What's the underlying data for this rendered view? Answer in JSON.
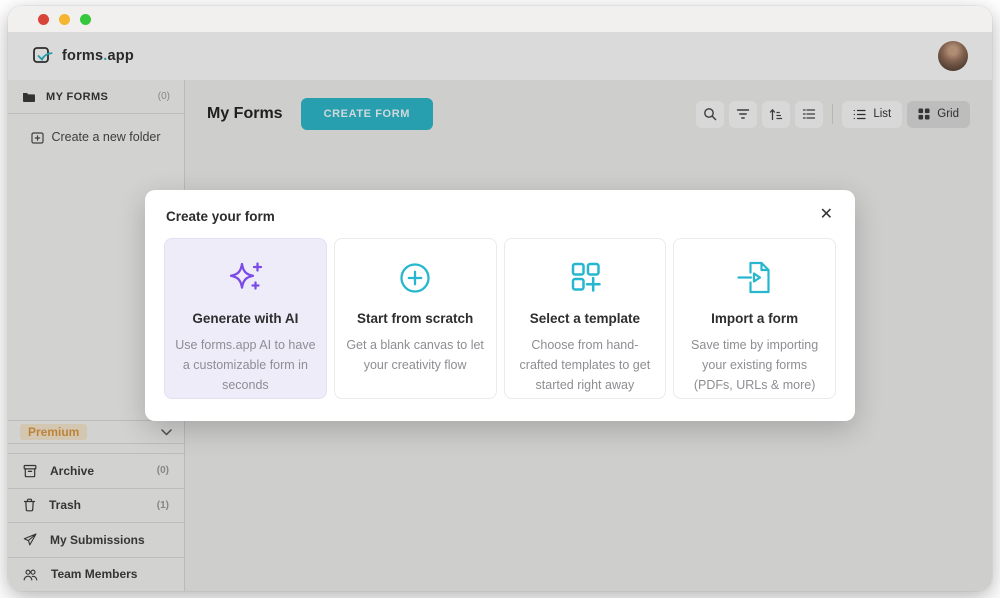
{
  "colors": {
    "accent_teal": "#29b6c6",
    "icon_teal": "#26b7cf",
    "ai_purple": "#7b4ce8",
    "ai_card_bg": "#efecfa",
    "premium_orange": "#dd9840",
    "traffic_red": "#d8433a",
    "traffic_yellow": "#f5b52e",
    "traffic_green": "#35c83c"
  },
  "brand": {
    "name_a": "forms",
    "dot": ".",
    "name_b": "app"
  },
  "sidebar": {
    "my_forms": {
      "label": "MY FORMS",
      "count": "(0)"
    },
    "create_folder_label": "Create a new folder",
    "premium_label": "Premium",
    "items": [
      {
        "label": "Archive",
        "count": "(0)",
        "icon": "archive-icon"
      },
      {
        "label": "Trash",
        "count": "(1)",
        "icon": "trash-icon"
      },
      {
        "label": "My Submissions",
        "count": "",
        "icon": "send-icon"
      },
      {
        "label": "Team Members",
        "count": "",
        "icon": "team-icon"
      }
    ]
  },
  "toolbar": {
    "title": "My Forms",
    "create_button_label": "CREATE FORM",
    "list_label": "List",
    "grid_label": "Grid",
    "icons": [
      "search-icon",
      "filter-icon",
      "sort-ascending-icon",
      "list-filter-icon"
    ]
  },
  "modal": {
    "title": "Create your form",
    "close_label": "✕",
    "cards": [
      {
        "title": "Generate with AI",
        "desc": "Use forms.app AI to have a customizable form in seconds",
        "icon": "ai-sparkle-icon"
      },
      {
        "title": "Start from scratch",
        "desc": "Get a blank canvas to let your creativity flow",
        "icon": "plus-circle-icon"
      },
      {
        "title": "Select a template",
        "desc": "Choose from hand-crafted templates to get started right away",
        "icon": "template-grid-icon"
      },
      {
        "title": "Import a form",
        "desc": "Save time by importing your existing forms (PDFs, URLs & more)",
        "icon": "import-document-icon"
      }
    ]
  }
}
